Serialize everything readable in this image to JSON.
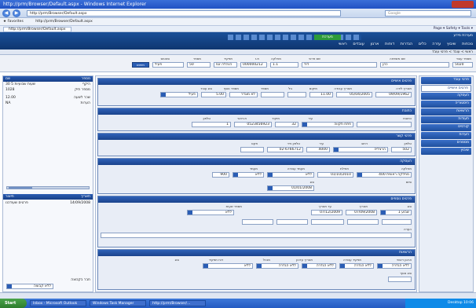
{
  "window": {
    "title": "http://prm/Browser/Default.aspx - Windows Internet Explorer"
  },
  "address": {
    "url": "http://prm/Browser/Default.aspx",
    "search_placeholder": "Google"
  },
  "favorites": {
    "label": "Favorites",
    "item": "http://prm/Browser/Default.aspx"
  },
  "tab": {
    "label": "http://prm/Browser/Default.aspx",
    "tools": "Page ▾  Safety ▾  Tools ▾"
  },
  "header": {
    "status_chip": "מערכת",
    "system_name": "מערכת מידע",
    "menu": [
      "ראשי",
      "עובדים",
      "ארגון",
      "דוחות",
      "הגדרות",
      "כלים",
      "עזרה",
      "שיבוץ",
      "נוכחות"
    ]
  },
  "breadcrumb": "ראשי > עובד > פרטי עובד",
  "filter": {
    "fields": [
      {
        "label": "מספר עובד",
        "value": "5020"
      },
      {
        "label": "שם משפחה",
        "value": "כהן"
      },
      {
        "label": "שם פרטי",
        "value": "דוד"
      },
      {
        "label": "מחלקה",
        "value": "1.1"
      },
      {
        "label": "ת.ז",
        "value": "000000212"
      },
      {
        "label": "תפקיד",
        "value": "הנהלה 02"
      },
      {
        "label": "מספר",
        "value": "50"
      },
      {
        "label": "סטטוס",
        "value": "פעיל"
      }
    ],
    "search_button": "חיפוש"
  },
  "left_panel": {
    "header": [
      "מספר",
      "שם"
    ],
    "rows": [
      {
        "a": "30 שעות שבועיות 5",
        "b": "היקף"
      },
      {
        "a": "1028",
        "b": "מספר תיק"
      },
      {
        "a": "12.00",
        "b": "שכר לשעה"
      },
      {
        "a": "NA",
        "b": "הערות"
      }
    ],
    "second_header": [
      "תאריך",
      "תיאור"
    ],
    "second_rows": [
      {
        "a": "14/09/2008",
        "b": "פרטים שעודכנו"
      }
    ],
    "bottom_label": "חבר בקבוצה",
    "bottom_value": "ללא קבוצה"
  },
  "sections": {
    "s1": {
      "title": "פרטים אישיים",
      "labels": [
        "תאריך לידה",
        "תאריך עבודה",
        "מיקום",
        "גיל",
        "מספר",
        "מספר נוסף",
        "סוג עובד"
      ],
      "values": [
        "09/09/1962",
        "05/04/2005",
        "11.00",
        "5.00",
        "לא מוגדר",
        "פעיל"
      ]
    },
    "s2": {
      "title": "כתובת",
      "labels": [
        "כתובת",
        "עיר",
        "מיקוד",
        "ת.דואר",
        "טלפון"
      ],
      "values": [
        "פתח תקווה",
        "32",
        "0523456923",
        "1"
      ]
    },
    "s3": {
      "title": "פרטי קשר",
      "labels": [
        "טלפון",
        "רחוב",
        "עיר",
        "טלפון נייד",
        "פקס"
      ],
      "values": [
        "הרצליה",
        "4000",
        "02-6766712",
        "502"
      ]
    },
    "s4": {
      "title": "העסקה",
      "labels": [
        "מחלקה",
        "תחילת",
        "סיום",
        "מעמד",
        "מעמד עבודה",
        "שכר",
        "סוג"
      ],
      "values": [
        "מחלקה ראשית 400",
        "01/10/2010",
        "ללא",
        "ללא",
        "900",
        "01/01/2008"
      ]
    },
    "s5": {
      "title": "פרטים נוספים",
      "labels": [
        "סוג",
        "תאריך",
        "עד תאריך",
        "מספר שעות",
        "הערה"
      ],
      "values": [
        "1 שבוע",
        "07/09/2008",
        "07/12/2009",
        "ללא"
      ]
    },
    "s6": {
      "title": "הרשאות",
      "labels": [
        "ארגון ראשי",
        "תפקיד עבודה",
        "תאריך עדכון",
        "מנהל",
        "דוח תפקיד",
        "סוג",
        "סוג נוסף"
      ],
      "values": [
        "ללא הגדרה",
        "ללא הגדרה",
        "ללא הגדרה",
        "ללא הגדרה",
        "ללא"
      ]
    }
  },
  "right_nav": {
    "items": [
      "פרטי עובד",
      "פרטים אישיים",
      "העסקה",
      "היסטוריה",
      "הרשאות",
      "תעודות",
      "קורסים",
      "הערות",
      "מסמכים",
      "שיבוץ"
    ],
    "selected_index": 1
  },
  "taskbar": {
    "start": "Start",
    "items": [
      "Inbox - Microsoft Outlook",
      "Windows Task Manager",
      "http://prm/Browser/..."
    ],
    "tray": "Desktop  10:06"
  }
}
